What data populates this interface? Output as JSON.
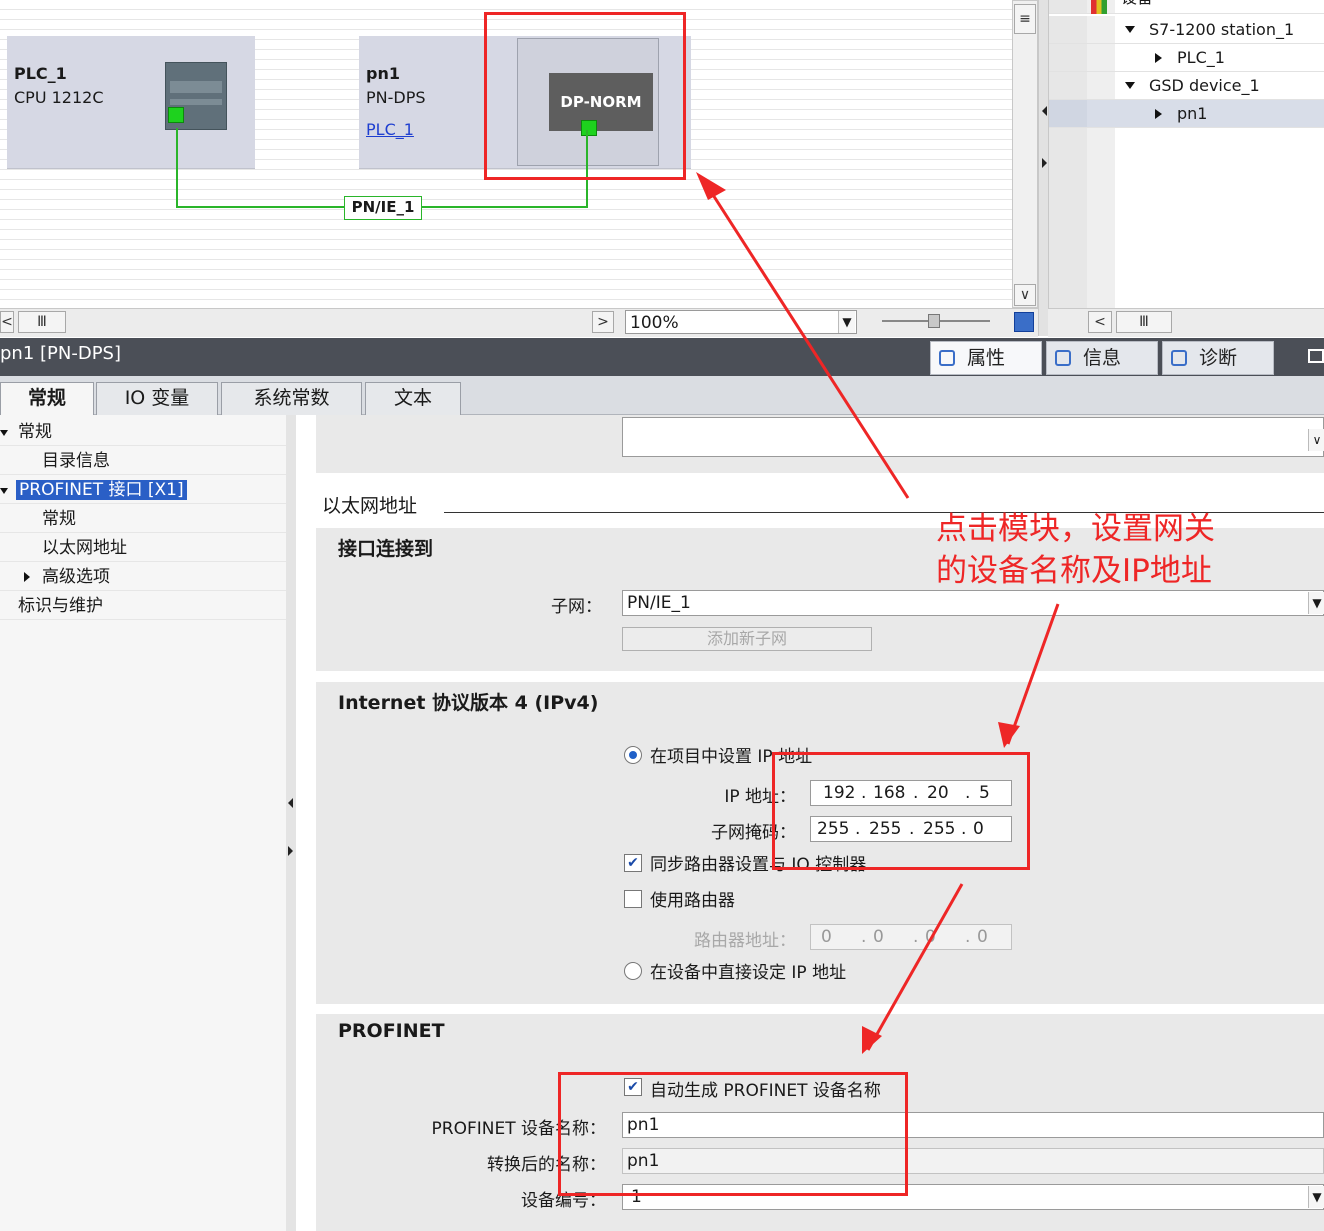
{
  "network_view": {
    "devices": [
      {
        "name": "PLC_1",
        "type": "CPU 1212C"
      },
      {
        "name": "pn1",
        "type": "PN-DPS",
        "link": "PLC_1",
        "module": "DP-NORM"
      }
    ],
    "subnet": "PN/IE_1",
    "zoom": "100%"
  },
  "device_tree": {
    "header": "设备",
    "items": [
      {
        "label": "S7-1200 station_1",
        "expanded": true,
        "level": 0
      },
      {
        "label": "PLC_1",
        "expanded": false,
        "level": 1
      },
      {
        "label": "GSD device_1",
        "expanded": true,
        "level": 0
      },
      {
        "label": "pn1",
        "expanded": false,
        "level": 1
      }
    ]
  },
  "properties": {
    "title": "pn1 [PN-DPS]",
    "right_tabs": [
      "属性",
      "信息",
      "诊断"
    ],
    "tabs": [
      "常规",
      "IO 变量",
      "系统常数",
      "文本"
    ],
    "nav": [
      "常规",
      "目录信息",
      "PROFINET 接口 [X1]",
      "常规",
      "以太网地址",
      "高级选项",
      "标识与维护"
    ],
    "ethernet_heading": "以太网地址",
    "interface": {
      "title": "接口连接到",
      "subnet_label": "子网：",
      "subnet_value": "PN/IE_1",
      "add_subnet_button": "添加新子网"
    },
    "ipv4": {
      "title": "Internet 协议版本 4 (IPv4)",
      "opt_project": "在项目中设置 IP 地址",
      "ip_label": "IP 地址：",
      "ip": [
        "192",
        "168",
        "20",
        "5"
      ],
      "mask_label": "子网掩码：",
      "mask": [
        "255",
        "255",
        "255",
        "0"
      ],
      "sync_router": "同步路由器设置与 IO 控制器",
      "use_router": "使用路由器",
      "router_label": "路由器地址：",
      "router": [
        "0",
        "0",
        "0",
        "0"
      ],
      "opt_device": "在设备中直接设定 IP 地址"
    },
    "profinet": {
      "title": "PROFINET",
      "auto_generate": "自动生成 PROFINET 设备名称",
      "name_label": "PROFINET 设备名称：",
      "name_value": "pn1",
      "converted_label": "转换后的名称：",
      "converted_value": "pn1",
      "number_label": "设备编号：",
      "number_value": "1"
    }
  },
  "annotation": {
    "line1": "点击模块，设置网关",
    "line2": "的设备名称及IP地址",
    "color": "#ee2626"
  }
}
